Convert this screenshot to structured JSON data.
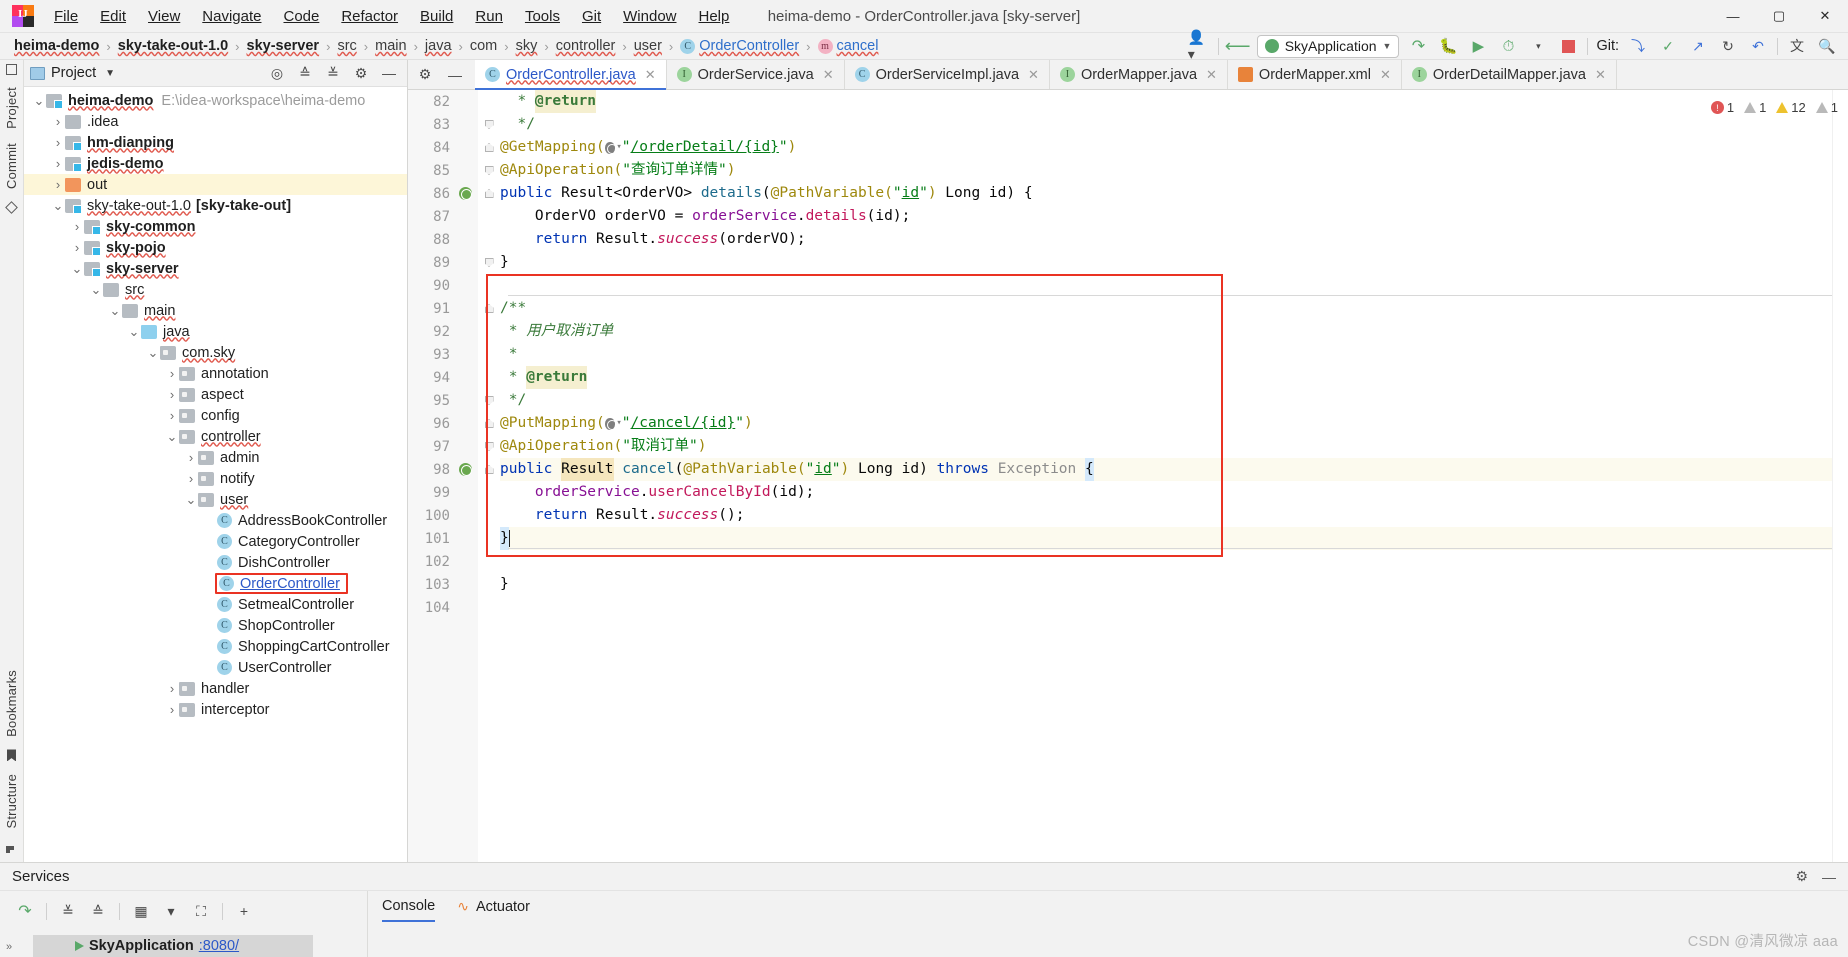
{
  "window": {
    "title": "heima-demo - OrderController.java [sky-server]",
    "minimize": "—",
    "maximize": "▢",
    "close": "✕"
  },
  "menubar": {
    "items": [
      {
        "label": "File",
        "mnemonic": "F"
      },
      {
        "label": "Edit",
        "mnemonic": "E"
      },
      {
        "label": "View",
        "mnemonic": "V"
      },
      {
        "label": "Navigate",
        "mnemonic": "N"
      },
      {
        "label": "Code",
        "mnemonic": "C"
      },
      {
        "label": "Refactor",
        "mnemonic": "R"
      },
      {
        "label": "Build",
        "mnemonic": "B"
      },
      {
        "label": "Run",
        "mnemonic": "u"
      },
      {
        "label": "Tools",
        "mnemonic": "T"
      },
      {
        "label": "Git",
        "mnemonic": "G"
      },
      {
        "label": "Window",
        "mnemonic": "W"
      },
      {
        "label": "Help",
        "mnemonic": "H"
      }
    ]
  },
  "breadcrumb": {
    "items": [
      {
        "label": "heima-demo",
        "style": "bold"
      },
      {
        "label": "sky-take-out-1.0",
        "style": "bold"
      },
      {
        "label": "sky-server",
        "style": "bold"
      },
      {
        "label": "src",
        "style": "plain"
      },
      {
        "label": "main",
        "style": "plain"
      },
      {
        "label": "java",
        "style": "plain"
      },
      {
        "label": "com",
        "style": "plain"
      },
      {
        "label": "sky",
        "style": "plain"
      },
      {
        "label": "controller",
        "style": "plain"
      },
      {
        "label": "user",
        "style": "plain"
      },
      {
        "label": "OrderController",
        "style": "link",
        "icon": "class-icon",
        "icon_letter": "C"
      },
      {
        "label": "cancel",
        "style": "link",
        "icon": "method-icon",
        "icon_letter": "m"
      }
    ],
    "separator": "›"
  },
  "toolbar": {
    "account_icon": "user-account-icon",
    "back_icon": "back-arrow-icon",
    "run_config": "SkyApplication",
    "run_config_caret": "▼",
    "run_icon": "run-icon",
    "debug_icon": "debug-icon",
    "run_with_coverage_icon": "run-coverage-icon",
    "profiler_icon": "profiler-icon",
    "stop_icon": "stop-icon",
    "git_label": "Git:",
    "git_update_icon": "git-update-icon",
    "git_commit_icon": "git-commit-icon",
    "git_push_icon": "git-push-icon",
    "history_icon": "history-icon",
    "undo_icon": "undo-icon",
    "translate_icon": "translate-icon",
    "search_icon": "search-icon"
  },
  "left_rail": {
    "top": [
      "Project",
      "Commit"
    ],
    "bottom": [
      "Bookmarks",
      "Structure"
    ]
  },
  "project_panel": {
    "title": "Project",
    "chevron": "▼",
    "tools": [
      "locate-icon",
      "collapse-all-icon",
      "expand-all-icon",
      "settings-icon",
      "hide-icon"
    ],
    "tree": [
      {
        "indent": 0,
        "arrow": "down",
        "icon": "module-folder",
        "label": "heima-demo",
        "bold": true,
        "path": "E:\\idea-workspace\\heima-demo"
      },
      {
        "indent": 1,
        "arrow": "right",
        "icon": "plain-folder",
        "label": ".idea",
        "bold": false
      },
      {
        "indent": 1,
        "arrow": "right",
        "icon": "module-folder",
        "label": "hm-dianping",
        "bold": true
      },
      {
        "indent": 1,
        "arrow": "right",
        "icon": "module-folder",
        "label": "jedis-demo",
        "bold": true
      },
      {
        "indent": 1,
        "arrow": "right",
        "icon": "excluded-folder",
        "label": "out",
        "bold": false,
        "highlighted": true
      },
      {
        "indent": 1,
        "arrow": "down",
        "icon": "module-folder",
        "label": "sky-take-out-1.0",
        "bold": false,
        "suffix": "[sky-take-out]"
      },
      {
        "indent": 2,
        "arrow": "right",
        "icon": "module-folder",
        "label": "sky-common",
        "bold": true
      },
      {
        "indent": 2,
        "arrow": "right",
        "icon": "module-folder",
        "label": "sky-pojo",
        "bold": true
      },
      {
        "indent": 2,
        "arrow": "down",
        "icon": "module-folder",
        "label": "sky-server",
        "bold": true
      },
      {
        "indent": 3,
        "arrow": "down",
        "icon": "plain-folder",
        "label": "src",
        "bold": false
      },
      {
        "indent": 4,
        "arrow": "down",
        "icon": "plain-folder",
        "label": "main",
        "bold": false
      },
      {
        "indent": 5,
        "arrow": "down",
        "icon": "source-folder",
        "label": "java",
        "bold": false
      },
      {
        "indent": 6,
        "arrow": "down",
        "icon": "package-folder",
        "label": "com.sky",
        "bold": false
      },
      {
        "indent": 7,
        "arrow": "right",
        "icon": "package-folder",
        "label": "annotation",
        "bold": false
      },
      {
        "indent": 7,
        "arrow": "right",
        "icon": "package-folder",
        "label": "aspect",
        "bold": false
      },
      {
        "indent": 7,
        "arrow": "right",
        "icon": "package-folder",
        "label": "config",
        "bold": false
      },
      {
        "indent": 7,
        "arrow": "down",
        "icon": "package-folder",
        "label": "controller",
        "bold": false
      },
      {
        "indent": 8,
        "arrow": "right",
        "icon": "package-folder",
        "label": "admin",
        "bold": false
      },
      {
        "indent": 8,
        "arrow": "right",
        "icon": "package-folder",
        "label": "notify",
        "bold": false
      },
      {
        "indent": 8,
        "arrow": "down",
        "icon": "package-folder",
        "label": "user",
        "bold": false
      },
      {
        "indent": 9,
        "arrow": "none",
        "icon": "class-icon",
        "label": "AddressBookController",
        "bold": false
      },
      {
        "indent": 9,
        "arrow": "none",
        "icon": "class-icon",
        "label": "CategoryController",
        "bold": false
      },
      {
        "indent": 9,
        "arrow": "none",
        "icon": "class-icon",
        "label": "DishController",
        "bold": false
      },
      {
        "indent": 9,
        "arrow": "none",
        "icon": "class-icon",
        "label": "OrderController",
        "bold": false,
        "selected": true,
        "boxed": true
      },
      {
        "indent": 9,
        "arrow": "none",
        "icon": "class-icon",
        "label": "SetmealController",
        "bold": false
      },
      {
        "indent": 9,
        "arrow": "none",
        "icon": "class-icon",
        "label": "ShopController",
        "bold": false
      },
      {
        "indent": 9,
        "arrow": "none",
        "icon": "class-icon",
        "label": "ShoppingCartController",
        "bold": false
      },
      {
        "indent": 9,
        "arrow": "none",
        "icon": "class-icon",
        "label": "UserController",
        "bold": false
      },
      {
        "indent": 7,
        "arrow": "right",
        "icon": "package-folder",
        "label": "handler",
        "bold": false
      },
      {
        "indent": 7,
        "arrow": "right",
        "icon": "package-folder",
        "label": "interceptor",
        "bold": false
      }
    ]
  },
  "editor": {
    "tool_pin_icon": "pin-icon",
    "tool_minimize_icon": "minimize-icon",
    "tabs": [
      {
        "label": "OrderController.java",
        "icon": "class-icon",
        "icon_letter": "C",
        "active": true,
        "close": "✕"
      },
      {
        "label": "OrderService.java",
        "icon": "interface-icon",
        "icon_letter": "I",
        "active": false,
        "close": "✕"
      },
      {
        "label": "OrderServiceImpl.java",
        "icon": "class-icon",
        "icon_letter": "C",
        "active": false,
        "close": "✕"
      },
      {
        "label": "OrderMapper.java",
        "icon": "interface-icon",
        "icon_letter": "I",
        "active": false,
        "close": "✕"
      },
      {
        "label": "OrderMapper.xml",
        "icon": "xml-icon",
        "icon_letter": "",
        "active": false,
        "close": "✕"
      },
      {
        "label": "OrderDetailMapper.java",
        "icon": "interface-icon",
        "icon_letter": "I",
        "active": false,
        "close": "✕"
      }
    ],
    "inspections": [
      {
        "icon": "error-icon",
        "count": "1"
      },
      {
        "icon": "warning-gray-icon",
        "count": "1"
      },
      {
        "icon": "warning-yellow-icon",
        "count": "12"
      },
      {
        "icon": "warning-gray-icon",
        "count": "1"
      }
    ],
    "first_line_number": 82,
    "lines": [
      {
        "n": 82,
        "text": " * @return",
        "segments": [
          {
            "t": "  * ",
            "c": "jdoc"
          },
          {
            "t": "@return",
            "c": "tag"
          }
        ]
      },
      {
        "n": 83,
        "text": " */",
        "segments": [
          {
            "t": "  */",
            "c": "jdoc"
          }
        ],
        "fold": "up"
      },
      {
        "n": 84,
        "text": "@GetMapping(\"/orderDetail/{id}\")",
        "fold": "down"
      },
      {
        "n": 85,
        "text": "@ApiOperation(\"查询订单详情\")",
        "fold": "up"
      },
      {
        "n": 86,
        "text": "public Result<OrderVO> details(@PathVariable(\"id\") Long id) {",
        "gutter_icon": "web-endpoint-icon",
        "fold": "down"
      },
      {
        "n": 87,
        "text": "    OrderVO orderVO = orderService.details(id);"
      },
      {
        "n": 88,
        "text": "    return Result.success(orderVO);"
      },
      {
        "n": 89,
        "text": "}",
        "fold": "up"
      },
      {
        "n": 90,
        "text": ""
      },
      {
        "n": 91,
        "text": "/**",
        "fold": "down"
      },
      {
        "n": 92,
        "text": " * 用户取消订单"
      },
      {
        "n": 93,
        "text": " *"
      },
      {
        "n": 94,
        "text": " * @return"
      },
      {
        "n": 95,
        "text": " */",
        "fold": "up"
      },
      {
        "n": 96,
        "text": "@PutMapping(\"/cancel/{id}\")",
        "fold": "down"
      },
      {
        "n": 97,
        "text": "@ApiOperation(\"取消订单\")",
        "fold": "up"
      },
      {
        "n": 98,
        "text": "public Result cancel(@PathVariable(\"id\") Long id) throws Exception {",
        "gutter_icon": "web-endpoint-icon",
        "fold": "down"
      },
      {
        "n": 99,
        "text": "    orderService.userCancelById(id);"
      },
      {
        "n": 100,
        "text": "    return Result.success();"
      },
      {
        "n": 101,
        "text": "}",
        "highlighted": true
      },
      {
        "n": 102,
        "text": ""
      },
      {
        "n": 103,
        "text": "}"
      },
      {
        "n": 104,
        "text": ""
      }
    ],
    "tokens": {
      "getmapping": "@GetMapping",
      "putmapping": "@PutMapping",
      "apioperation": "@ApiOperation",
      "pathvariable": "@PathVariable",
      "url_order_detail": "/orderDetail/{id}",
      "url_cancel": "/cancel/{id}",
      "api_desc_details": "查询订单详情",
      "api_desc_cancel": "取消订单",
      "javadoc_cancel": "用户取消订单",
      "javadoc_return": "@return",
      "kw_public": "public",
      "kw_return": "return",
      "kw_throws": "throws",
      "type_result": "Result",
      "type_result_ordervo": "Result<OrderVO>",
      "type_ordervo": "OrderVO",
      "type_long": "Long",
      "type_exception": "Exception",
      "m_details": "details",
      "m_cancel": "cancel",
      "m_success": "success",
      "m_user_cancel": "userCancelById",
      "f_order_service": "orderService",
      "v_order_vo": "orderVO",
      "v_id": "id",
      "str_id": "\"id\""
    }
  },
  "services": {
    "title": "Services",
    "header_right_icons": [
      "settings-icon",
      "hide-icon"
    ],
    "toolbar_icons": [
      "rerun-icon",
      "expand-all-icon",
      "collapse-all-icon",
      "group-icon",
      "filter-icon",
      "new-tab-icon",
      "add-icon"
    ],
    "tree_item": {
      "name": "SkyApplication",
      "port": ":8080/",
      "run_icon": "running-icon"
    },
    "tabs": [
      {
        "label": "Console",
        "active": true
      },
      {
        "label": "Actuator",
        "active": false,
        "icon": "actuator-icon"
      }
    ],
    "expand_rail": "»"
  },
  "watermark": "CSDN @清风微凉 aaa",
  "colors": {
    "accent_blue": "#2c58c8",
    "highlight_red": "#ea3323",
    "row_highlight": "#fdf6d8",
    "tab_active_underline": "#3f72d8",
    "run_green": "#59a869",
    "stop_red": "#e05555"
  }
}
